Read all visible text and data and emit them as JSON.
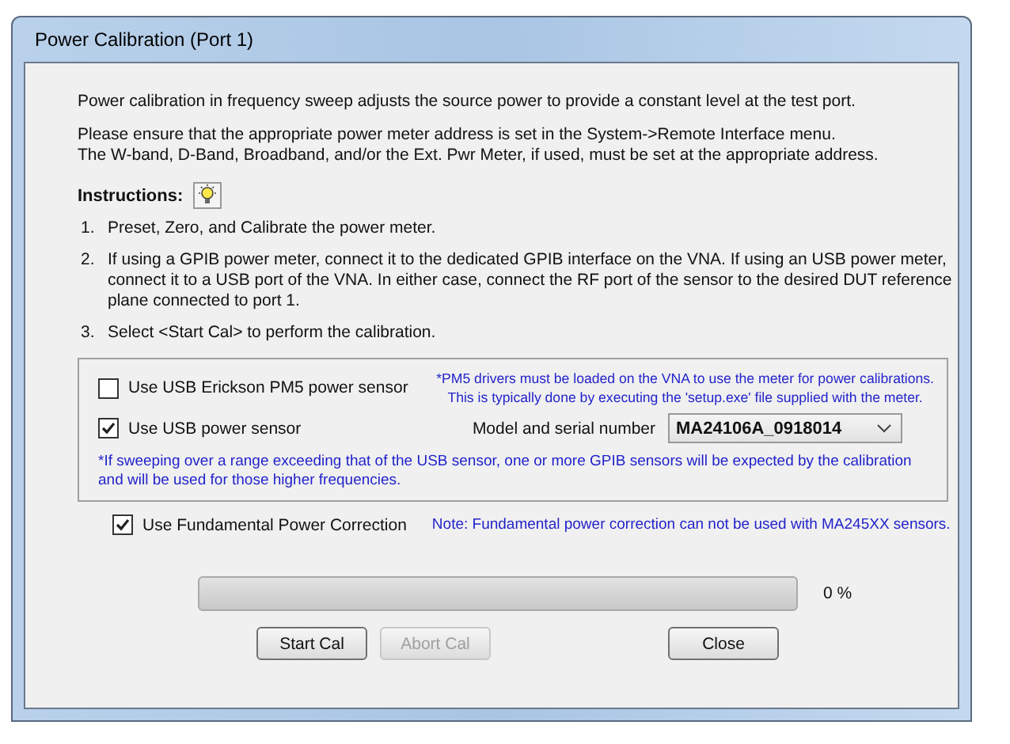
{
  "window": {
    "title": "Power Calibration (Port 1)"
  },
  "intro": [
    "Power calibration in frequency sweep adjusts the source power to provide a constant level at the test port.",
    "Please ensure that the appropriate power meter address is set in the System->Remote Interface menu.\nThe W-band, D-Band, Broadband, and/or the Ext. Pwr Meter, if used, must be set at the appropriate address."
  ],
  "instructions_label": "Instructions:",
  "steps": [
    {
      "number": "1.",
      "text": "Preset, Zero, and Calibrate the power meter."
    },
    {
      "number": "2.",
      "text": "If using a GPIB power meter, connect it to the dedicated GPIB interface on the VNA.  If using an USB power meter, connect it to a USB port of the VNA.  In either case, connect the RF port of the sensor to the desired DUT reference plane connected to port 1."
    },
    {
      "number": "3.",
      "text": "Select <Start Cal> to perform the calibration."
    }
  ],
  "sensor_group": {
    "pm5": {
      "label": "Use USB Erickson PM5 power sensor",
      "checked": false,
      "note": "*PM5 drivers must be loaded on the VNA to use the meter for power calibrations.\nThis is typically done by executing the 'setup.exe' file supplied with the meter."
    },
    "usb": {
      "label": "Use USB power sensor",
      "checked": true,
      "model_label": "Model and serial number",
      "model_value": "MA24106A_0918014"
    },
    "note": "*If sweeping over a range exceeding that of the USB sensor, one or more GPIB sensors will be expected by the calibration and will be used for those higher frequencies."
  },
  "fundamental": {
    "label": "Use Fundamental Power Correction",
    "checked": true,
    "note": "Note: Fundamental power correction can not be used with MA245XX sensors."
  },
  "progress": {
    "level": 0,
    "reading": "0 %"
  },
  "buttons": [
    {
      "label": "Start Cal",
      "disabled": false
    },
    {
      "label": "Abort Cal",
      "disabled": true
    },
    {
      "label": "Close",
      "disabled": false
    }
  ]
}
